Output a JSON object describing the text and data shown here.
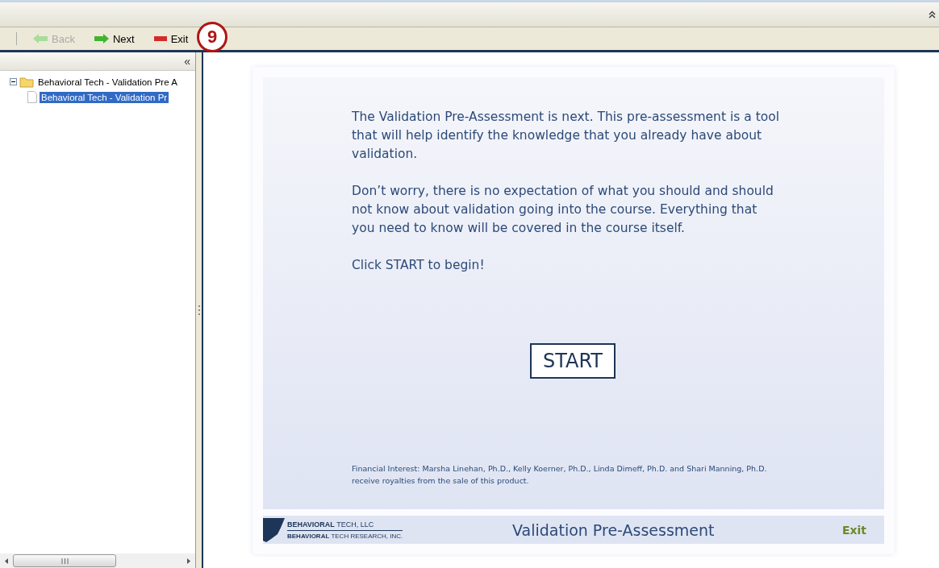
{
  "toolbar": {
    "buttons": [
      {
        "label": "Back",
        "kind": "back",
        "disabled": true
      },
      {
        "label": "Next",
        "kind": "next",
        "disabled": false
      },
      {
        "label": "Exit",
        "kind": "exit",
        "disabled": false
      }
    ]
  },
  "annotation": {
    "number": "9"
  },
  "sidebar": {
    "collapse": "«",
    "tree": [
      {
        "label": "Behavioral Tech - Validation Pre A",
        "expanded": true,
        "selected": false,
        "children": [
          {
            "label": "Behavioral Tech - Validation Pr",
            "selected": true
          }
        ]
      }
    ]
  },
  "slide": {
    "paragraphs": [
      "The Validation Pre-Assessment is next. This pre-assessment is a tool that will help identify the knowledge that you already have about validation.",
      "Don’t worry, there is no expectation of what you should and should not know about validation going into the course. Everything that you need to know  will be covered in the course itself.",
      "Click START to begin!"
    ],
    "start_button": "START",
    "disclaimer": "Financial Interest:  Marsha Linehan, Ph.D., Kelly Koerner, Ph.D., Linda Dimeff, Ph.D. and Shari Manning, Ph.D. receive royalties from the sale of this product.",
    "footer": {
      "logo_lines": [
        "**BEHAVIORAL** TECH, LLC",
        "**BEHAVIORAL** TECH RESEARCH, INC."
      ],
      "title": "Validation Pre-Assessment",
      "exit": "Exit"
    }
  }
}
